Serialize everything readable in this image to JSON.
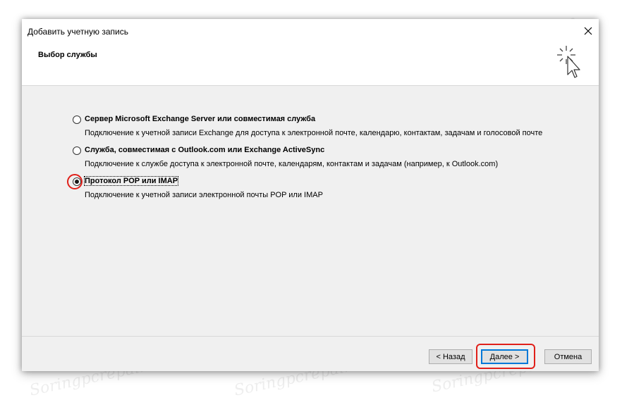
{
  "window": {
    "title": "Добавить учетную запись",
    "close_glyph": "✕"
  },
  "header": {
    "section_title": "Выбор службы",
    "icon": "cursor-sparkle-icon"
  },
  "options": [
    {
      "label": "Сервер Microsoft Exchange Server или совместимая служба",
      "description": "Подключение к учетной записи Exchange для доступа к электронной почте, календарю, контактам, задачам и голосовой почте",
      "checked": false
    },
    {
      "label": "Служба, совместимая с Outlook.com или Exchange ActiveSync",
      "description": "Подключение к службе доступа к электронной почте, календарям, контактам и задачам (например, к Outlook.com)",
      "checked": false
    },
    {
      "label": "Протокол POP или IMAP",
      "description": "Подключение к учетной записи электронной почты POP или IMAP",
      "checked": true
    }
  ],
  "buttons": {
    "back": "< Назад",
    "next": "Далее >",
    "cancel": "Отмена"
  },
  "colors": {
    "highlight": "#e0201a",
    "default_button_border": "#0078d7",
    "dialog_bg": "#f0f0f0"
  },
  "watermark": "Soringpcrepair.com"
}
